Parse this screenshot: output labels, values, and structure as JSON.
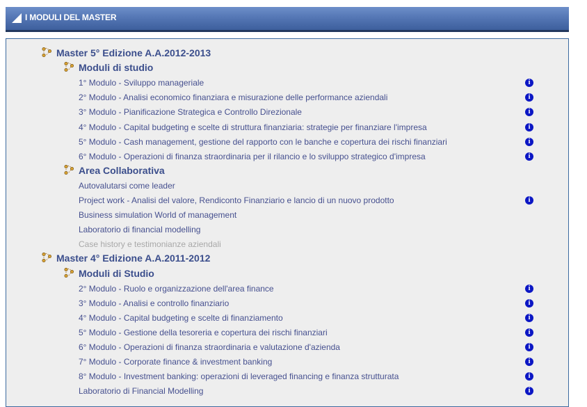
{
  "header": {
    "title": "I MODULI DEL MASTER",
    "icon": "triangle-corner-icon"
  },
  "tree": [
    {
      "label": "Master 5° Edizione A.A.2012-2013",
      "icon": "tree-node-icon",
      "groups": [
        {
          "label": "Moduli di studio",
          "icon": "tree-node-icon",
          "items": [
            {
              "label": "1° Modulo - Sviluppo manageriale",
              "info": true,
              "enabled": true
            },
            {
              "label": "2° Modulo - Analisi economico finanziara e misurazione delle performance aziendali",
              "info": true,
              "enabled": true
            },
            {
              "label": "3° Modulo - Pianificazione Strategica e Controllo Direzionale",
              "info": true,
              "enabled": true
            },
            {
              "label": "4° Modulo - Capital budgeting e scelte di struttura finanziaria: strategie per finanziare l'impresa",
              "info": true,
              "enabled": true
            },
            {
              "label": "5° Modulo - Cash management, gestione del rapporto con le banche e copertura dei rischi finanziari",
              "info": true,
              "enabled": true
            },
            {
              "label": "6° Modulo - Operazioni di finanza straordinaria per il rilancio e lo sviluppo strategico d'impresa",
              "info": true,
              "enabled": true
            }
          ]
        },
        {
          "label": "Area Collaborativa",
          "icon": "tree-node-icon",
          "items": [
            {
              "label": "Autovalutarsi come leader",
              "info": false,
              "enabled": true
            },
            {
              "label": "Project work - Analisi del valore, Rendiconto Finanziario e lancio di un nuovo prodotto",
              "info": true,
              "enabled": true
            },
            {
              "label": "Business simulation World of management",
              "info": false,
              "enabled": true
            },
            {
              "label": "Laboratorio di financial modelling",
              "info": false,
              "enabled": true
            },
            {
              "label": "Case history e testimonianze aziendali",
              "info": false,
              "enabled": false
            }
          ]
        }
      ]
    },
    {
      "label": "Master 4° Edizione A.A.2011-2012",
      "icon": "tree-node-icon",
      "groups": [
        {
          "label": "Moduli di Studio",
          "icon": "tree-node-icon",
          "items": [
            {
              "label": "2° Modulo - Ruolo e organizzazione dell'area finance",
              "info": true,
              "enabled": true
            },
            {
              "label": "3° Modulo - Analisi e controllo finanziario",
              "info": true,
              "enabled": true
            },
            {
              "label": "4° Modulo - Capital budgeting e scelte di finanziamento",
              "info": true,
              "enabled": true
            },
            {
              "label": "5° Modulo - Gestione della tesoreria e copertura dei rischi finanziari",
              "info": true,
              "enabled": true
            },
            {
              "label": "6° Modulo - Operazioni di finanza straordinaria e valutazione d'azienda",
              "info": true,
              "enabled": true
            },
            {
              "label": "7° Modulo - Corporate finance & investment banking",
              "info": true,
              "enabled": true
            },
            {
              "label": "8° Modulo - Investment banking: operazioni di leveraged financing e finanza strutturata",
              "info": true,
              "enabled": true
            },
            {
              "label": "Laboratorio di Financial Modelling",
              "info": true,
              "enabled": true
            }
          ]
        }
      ]
    }
  ],
  "info_icon_glyph": "i",
  "colors": {
    "link": "#46508f",
    "heading": "#3b4e8c",
    "disabled": "#a8a8a8",
    "info": "#0b16c4",
    "panel_bg": "#eeeeee",
    "panel_border": "#3c6aa0"
  }
}
